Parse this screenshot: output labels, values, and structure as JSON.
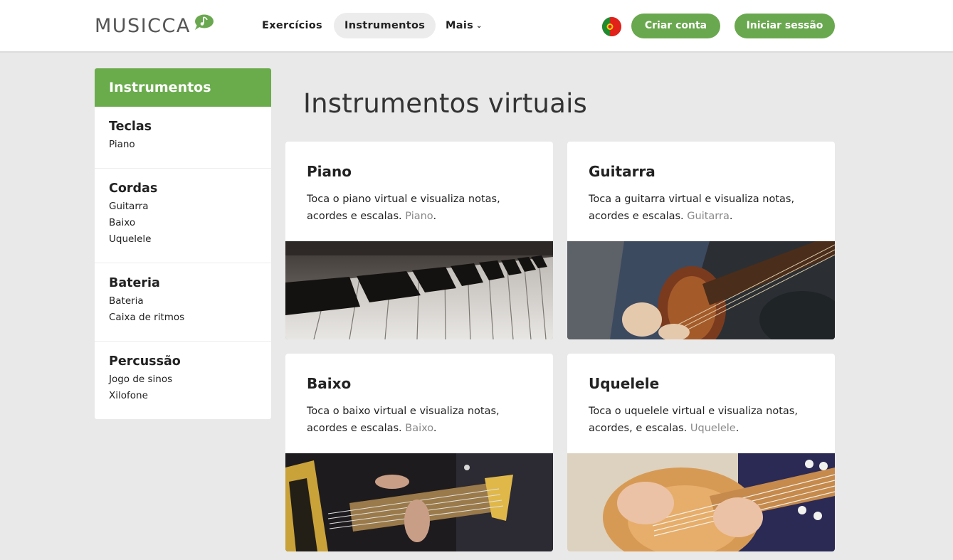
{
  "header": {
    "logo": "MUSICCA",
    "nav": [
      {
        "label": "Exercícios"
      },
      {
        "label": "Instrumentos"
      },
      {
        "label": "Mais"
      }
    ],
    "create_account": "Criar conta",
    "sign_in": "Iniciar sessão"
  },
  "sidebar": {
    "title": "Instrumentos",
    "groups": [
      {
        "title": "Teclas",
        "items": [
          "Piano"
        ]
      },
      {
        "title": "Cordas",
        "items": [
          "Guitarra",
          "Baixo",
          "Uquelele"
        ]
      },
      {
        "title": "Bateria",
        "items": [
          "Bateria",
          "Caixa de ritmos"
        ]
      },
      {
        "title": "Percussão",
        "items": [
          "Jogo de sinos",
          "Xilofone"
        ]
      }
    ]
  },
  "main": {
    "title": "Instrumentos virtuais",
    "cards": [
      {
        "title": "Piano",
        "desc": "Toca o piano virtual e visualiza notas, acordes e escalas. ",
        "link": "Piano",
        "end": "."
      },
      {
        "title": "Guitarra",
        "desc": "Toca a guitarra virtual e visualiza notas, acordes e escalas. ",
        "link": "Guitarra",
        "end": "."
      },
      {
        "title": "Baixo",
        "desc": "Toca o baixo virtual e visualiza notas, acordes e escalas. ",
        "link": "Baixo",
        "end": "."
      },
      {
        "title": "Uquelele",
        "desc": "Toca o uquelele virtual e visualiza notas, acordes, e escalas. ",
        "link": "Uquelele",
        "end": "."
      }
    ]
  },
  "colors": {
    "accent": "#6aa84f",
    "background": "#e9e9e9"
  }
}
